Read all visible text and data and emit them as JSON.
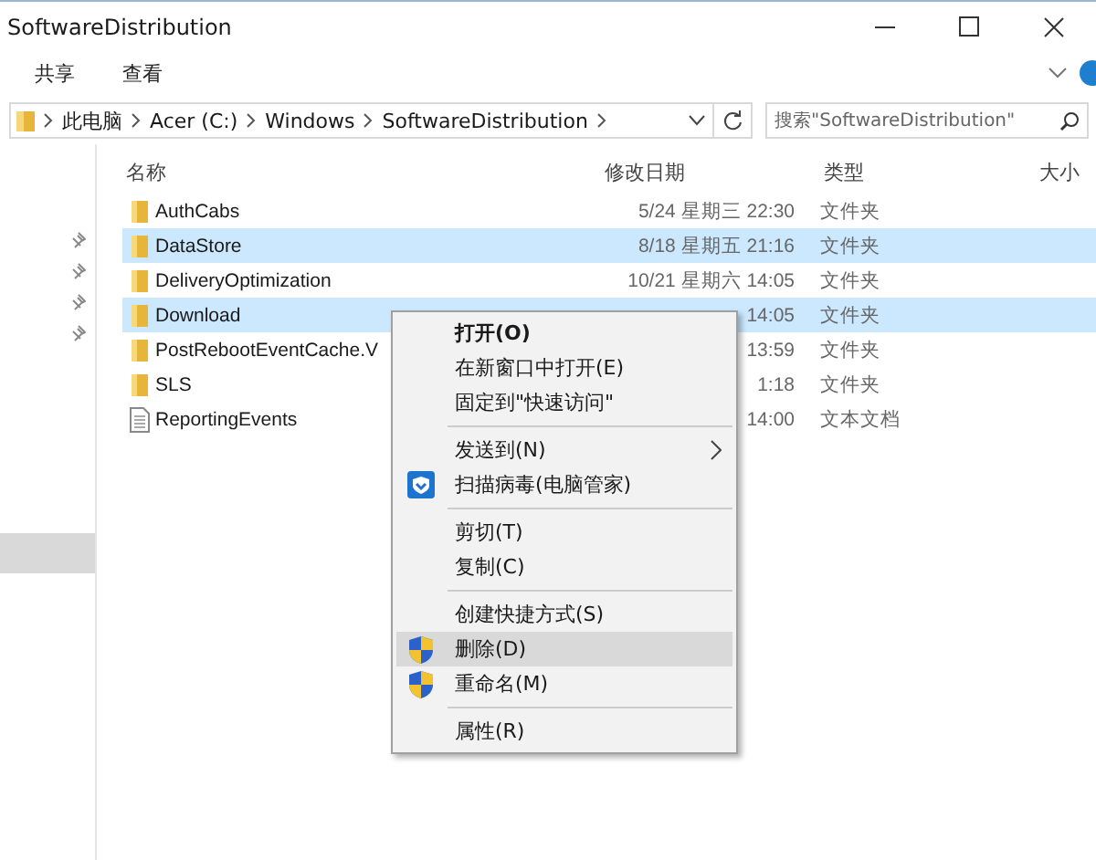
{
  "window": {
    "title": "SoftwareDistribution"
  },
  "ribbon_tabs": [
    {
      "label": "共享",
      "selected": false
    },
    {
      "label": "查看",
      "selected": false
    }
  ],
  "address": {
    "crumbs": [
      "此电脑",
      "Acer (C:)",
      "Windows",
      "SoftwareDistribution"
    ]
  },
  "search": {
    "placeholder": "搜索\"SoftwareDistribution\""
  },
  "table": {
    "columns": [
      "名称",
      "修改日期",
      "类型",
      "大小"
    ],
    "rows": [
      {
        "kind": "folder",
        "name": "AuthCabs",
        "date": "5/24 星期三 22:30",
        "type": "文件夹",
        "selected": false
      },
      {
        "kind": "folder",
        "name": "DataStore",
        "date": "8/18 星期五 21:16",
        "type": "文件夹",
        "selected": true
      },
      {
        "kind": "folder",
        "name": "DeliveryOptimization",
        "date": "10/21 星期六 14:05",
        "type": "文件夹",
        "selected": false
      },
      {
        "kind": "folder",
        "name": "Download",
        "date": "14:05",
        "type": "文件夹",
        "selected": true
      },
      {
        "kind": "folder",
        "name": "PostRebootEventCache.V",
        "date": "13:59",
        "type": "文件夹",
        "selected": false
      },
      {
        "kind": "folder",
        "name": "SLS",
        "date": "1:18",
        "type": "文件夹",
        "selected": false
      },
      {
        "kind": "file",
        "name": "ReportingEvents",
        "date": "14:00",
        "type": "文本文档",
        "selected": false
      }
    ]
  },
  "context_menu": {
    "items": [
      {
        "kind": "plain",
        "label": "打开(O)",
        "bold": true,
        "submenu": false,
        "selected": false
      },
      {
        "kind": "plain",
        "label": "在新窗口中打开(E)",
        "bold": false,
        "submenu": false,
        "selected": false
      },
      {
        "kind": "plain",
        "label": "固定到\"快速访问\"",
        "bold": false,
        "submenu": false,
        "selected": false
      },
      {
        "kind": "separator"
      },
      {
        "kind": "plain",
        "label": "发送到(N)",
        "bold": false,
        "submenu": true,
        "selected": false
      },
      {
        "kind": "scan",
        "label": "扫描病毒(电脑管家)",
        "bold": false,
        "submenu": false,
        "selected": false
      },
      {
        "kind": "separator"
      },
      {
        "kind": "plain",
        "label": "剪切(T)",
        "bold": false,
        "submenu": false,
        "selected": false
      },
      {
        "kind": "plain",
        "label": "复制(C)",
        "bold": false,
        "submenu": false,
        "selected": false
      },
      {
        "kind": "separator"
      },
      {
        "kind": "plain",
        "label": "创建快捷方式(S)",
        "bold": false,
        "submenu": false,
        "selected": false
      },
      {
        "kind": "shield",
        "label": "删除(D)",
        "bold": false,
        "submenu": false,
        "selected": true
      },
      {
        "kind": "shield",
        "label": "重命名(M)",
        "bold": false,
        "submenu": false,
        "selected": false
      },
      {
        "kind": "separator"
      },
      {
        "kind": "plain",
        "label": "属性(R)",
        "bold": false,
        "submenu": false,
        "selected": false
      }
    ]
  }
}
